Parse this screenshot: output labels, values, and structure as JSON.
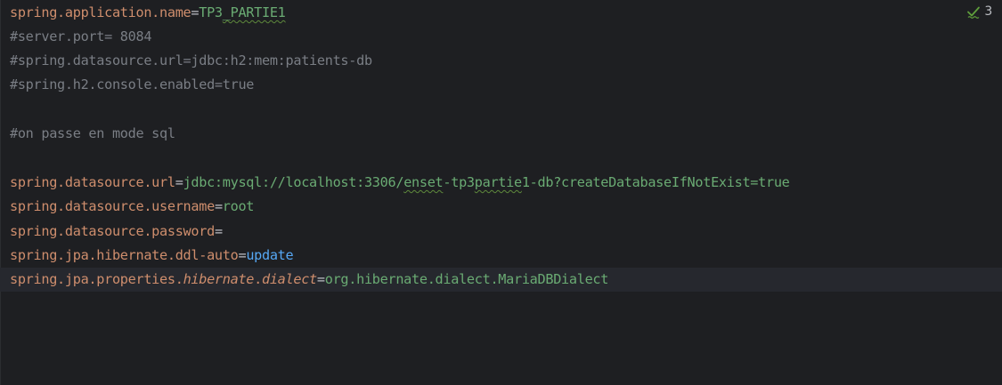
{
  "inspection": {
    "count": "3",
    "icon": "typo-check-icon",
    "color": "#5f9e3c"
  },
  "colors": {
    "background": "#1e1f22",
    "current_line": "#26282e",
    "key": "#cf8e6d",
    "value": "#6aab73",
    "keyword": "#56a8f5",
    "comment": "#7a7e85",
    "text": "#bcbec4"
  },
  "lines": [
    {
      "key": "spring.application.name",
      "eq": "=",
      "val_pre": "TP3",
      "val_typo": "_PARTIE1"
    },
    {
      "comment": "#server.port= 8084"
    },
    {
      "comment": "#spring.datasource.url=jdbc:h2:mem:patients-db"
    },
    {
      "comment": "#spring.h2.console.enabled=true"
    },
    {
      "comment": "#on passe en mode sql"
    },
    {
      "key": "spring.datasource.url",
      "eq": "=",
      "val_a": "jdbc:mysql://localhost:3306/",
      "val_typo1": "enset",
      "val_b": "-tp3",
      "val_typo2": "partie",
      "val_c": "1-db?createDatabaseIfNotExist=true"
    },
    {
      "key": "spring.datasource.username",
      "eq": "=",
      "val": "root"
    },
    {
      "key": "spring.datasource.password",
      "eq": "="
    },
    {
      "key": "spring.jpa.hibernate.ddl-auto",
      "eq": "=",
      "val": "update"
    },
    {
      "key_pre": "spring.jpa.properties.",
      "key_it1": "hibernate",
      "key_dot": ".",
      "key_it2": "dialect",
      "eq": "=",
      "val": "org.hibernate.dialect.MariaDBDialect"
    }
  ]
}
